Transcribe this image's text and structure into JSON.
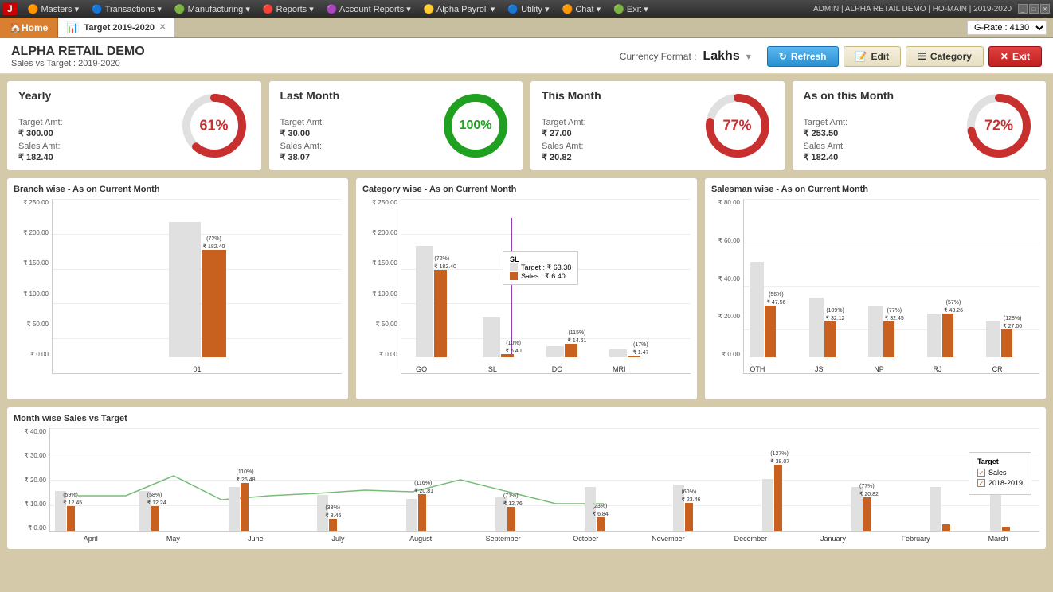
{
  "menubar": {
    "logo": "J",
    "items": [
      {
        "label": "Masters ▾",
        "icon": "M"
      },
      {
        "label": "Transactions ▾",
        "icon": "T"
      },
      {
        "label": "Manufacturing ▾",
        "icon": "F"
      },
      {
        "label": "Reports ▾",
        "icon": "R"
      },
      {
        "label": "Account Reports ▾",
        "icon": "E"
      },
      {
        "label": "Alpha Payroll ▾",
        "icon": "Y"
      },
      {
        "label": "Utility ▾",
        "icon": "U"
      },
      {
        "label": "Chat ▾",
        "icon": "Q"
      },
      {
        "label": "Exit ▾",
        "icon": "I"
      }
    ],
    "right_info": "ADMIN | ALPHA RETAIL DEMO | HO-MAIN | 2019-2020"
  },
  "tabbar": {
    "home_label": "🏠 Home",
    "active_tab_label": "Target 2019-2020",
    "g_rate_label": "G-Rate : 4130"
  },
  "header": {
    "company": "ALPHA RETAIL DEMO",
    "subtitle": "Sales vs Target :  2019-2020",
    "currency_label": "Currency Format :",
    "currency_value": "Lakhs",
    "btn_refresh": "Refresh",
    "btn_edit": "Edit",
    "btn_category": "Category",
    "btn_exit": "Exit"
  },
  "kpi": {
    "yearly": {
      "title": "Yearly",
      "percent": 61,
      "percent_label": "61%",
      "target_label": "Target Amt:",
      "target_value": "₹ 300.00",
      "sales_label": "Sales Amt:",
      "sales_value": "₹ 182.40",
      "color": "#c83030"
    },
    "last_month": {
      "title": "Last Month",
      "percent": 100,
      "percent_label": "100%",
      "target_label": "Target Amt:",
      "target_value": "₹ 30.00",
      "sales_label": "Sales Amt:",
      "sales_value": "₹ 38.07",
      "color": "#20a020"
    },
    "this_month": {
      "title": "This Month",
      "percent": 77,
      "percent_label": "77%",
      "target_label": "Target Amt:",
      "target_value": "₹ 27.00",
      "sales_label": "Sales Amt:",
      "sales_value": "₹ 20.82",
      "color": "#c83030"
    },
    "as_on_month": {
      "title": "As on this Month",
      "percent": 72,
      "percent_label": "72%",
      "target_label": "Target Amt:",
      "target_value": "₹ 253.50",
      "sales_label": "Sales Amt:",
      "sales_value": "₹ 182.40",
      "color": "#c83030"
    }
  },
  "branch_chart": {
    "title": "Branch wise - As on Current Month",
    "y_labels": [
      "₹ 250.00",
      "₹ 200.00",
      "₹ 150.00",
      "₹ 100.00",
      "₹ 50.00",
      "₹ 0.00"
    ],
    "bars": [
      {
        "label": "01",
        "target_h": 170,
        "sales_h": 135,
        "value": "₹ 182.40",
        "pct": "(72%)"
      }
    ]
  },
  "category_chart": {
    "title": "Category wise - As on Current Month",
    "y_labels": [
      "₹ 250.00",
      "₹ 200.00",
      "₹ 150.00",
      "₹ 100.00",
      "₹ 50.00",
      "₹ 0.00"
    ],
    "tooltip": {
      "label": "SL",
      "target": "Target : ₹ 63.38",
      "sales": "Sales : ₹ 6.40"
    },
    "bars": [
      {
        "label": "GO",
        "target_h": 140,
        "sales_h": 110,
        "value": "₹ 182.40",
        "pct": "(72%)"
      },
      {
        "label": "SL",
        "target_h": 50,
        "sales_h": 5,
        "value": "₹ 6.40",
        "pct": "(10%)"
      },
      {
        "label": "DO",
        "target_h": 15,
        "sales_h": 17,
        "value": "₹ 14.61",
        "pct": "(115%)"
      },
      {
        "label": "MRI",
        "target_h": 10,
        "sales_h": 2,
        "value": "₹ 1.47",
        "pct": "(17%)"
      }
    ]
  },
  "salesman_chart": {
    "title": "Salesman wise - As on Current Month",
    "y_labels": [
      "₹ 80.00",
      "₹ 60.00",
      "₹ 40.00",
      "₹ 20.00",
      "₹ 0.00"
    ],
    "bars": [
      {
        "label": "OTH",
        "target_h": 120,
        "sales_h": 65,
        "value": "₹ 47.56",
        "pct": "(56%)"
      },
      {
        "label": "JS",
        "target_h": 75,
        "sales_h": 45,
        "value": "₹ 32.12",
        "pct": "(109%)"
      },
      {
        "label": "NP",
        "target_h": 65,
        "sales_h": 45,
        "value": "₹ 32.45",
        "pct": "(77%)"
      },
      {
        "label": "RJ",
        "target_h": 55,
        "sales_h": 55,
        "value": "₹ 43.26",
        "pct": "(57%)"
      },
      {
        "label": "CR",
        "target_h": 45,
        "sales_h": 35,
        "value": "₹ 27.00",
        "pct": "(128%)"
      }
    ]
  },
  "monthly_chart": {
    "title": "Month wise Sales vs Target",
    "y_labels": [
      "₹ 40.00",
      "₹ 30.00",
      "₹ 20.00",
      "₹ 10.00",
      "₹ 0.00"
    ],
    "legend": {
      "target_label": "Target",
      "sales_label": "Sales",
      "prev_year_label": "2018-2019"
    },
    "months": [
      {
        "label": "April",
        "target_h": 50,
        "sales_h": 31,
        "value": "₹ 12.45",
        "pct": "(59%)"
      },
      {
        "label": "May",
        "target_h": 50,
        "sales_h": 31,
        "value": "₹ 12.24",
        "pct": "(58%)"
      },
      {
        "label": "June",
        "target_h": 55,
        "sales_h": 60,
        "value": "₹ 26.48",
        "pct": "(110%)"
      },
      {
        "label": "July",
        "target_h": 45,
        "sales_h": 19,
        "value": "₹ 8.46",
        "pct": "(33%)"
      },
      {
        "label": "August",
        "target_h": 40,
        "sales_h": 46,
        "value": "₹ 20.81",
        "pct": "(116%)"
      },
      {
        "label": "September",
        "target_h": 42,
        "sales_h": 30,
        "value": "₹ 12.76",
        "pct": "(71%)"
      },
      {
        "label": "October",
        "target_h": 55,
        "sales_h": 17,
        "value": "₹ 6.84",
        "pct": "(23%)"
      },
      {
        "label": "November",
        "target_h": 58,
        "sales_h": 35,
        "value": "₹ 23.46",
        "pct": "(60%)"
      },
      {
        "label": "December",
        "target_h": 65,
        "sales_h": 83,
        "value": "₹ 38.07",
        "pct": "(127%)"
      },
      {
        "label": "January",
        "target_h": 55,
        "sales_h": 42,
        "value": "₹ 20.82",
        "pct": "(77%)"
      },
      {
        "label": "February",
        "target_h": 55,
        "sales_h": 12,
        "value": "",
        "pct": ""
      },
      {
        "label": "March",
        "target_h": 55,
        "sales_h": 8,
        "value": "",
        "pct": ""
      }
    ]
  }
}
